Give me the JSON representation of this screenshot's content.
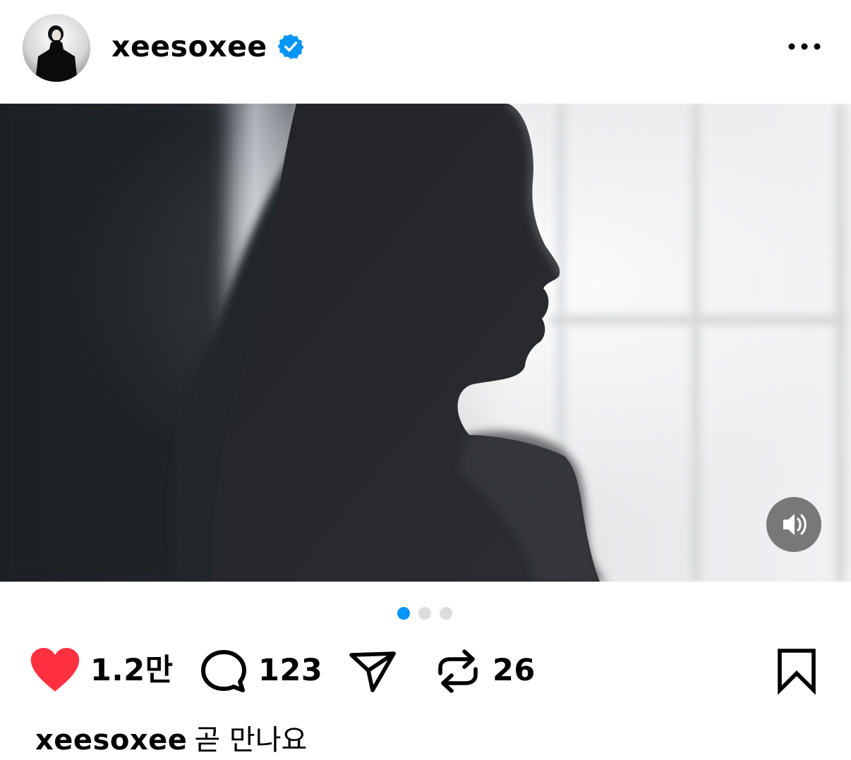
{
  "post": {
    "username": "xeesoxee",
    "verified": true,
    "more_icon": "more-horizontal-icon",
    "avatar_alt": "profile photo"
  },
  "media": {
    "sound_icon": "speaker-on-icon",
    "carousel_total": 3,
    "carousel_active": 1
  },
  "actions": {
    "like_count": "1.2만",
    "comment_count": "123",
    "repost_count": "26",
    "liked": true,
    "like_color": "#ff3040",
    "accent_color": "#0095f6"
  },
  "caption": {
    "username": "xeesoxee",
    "text": "곧 만나요"
  }
}
